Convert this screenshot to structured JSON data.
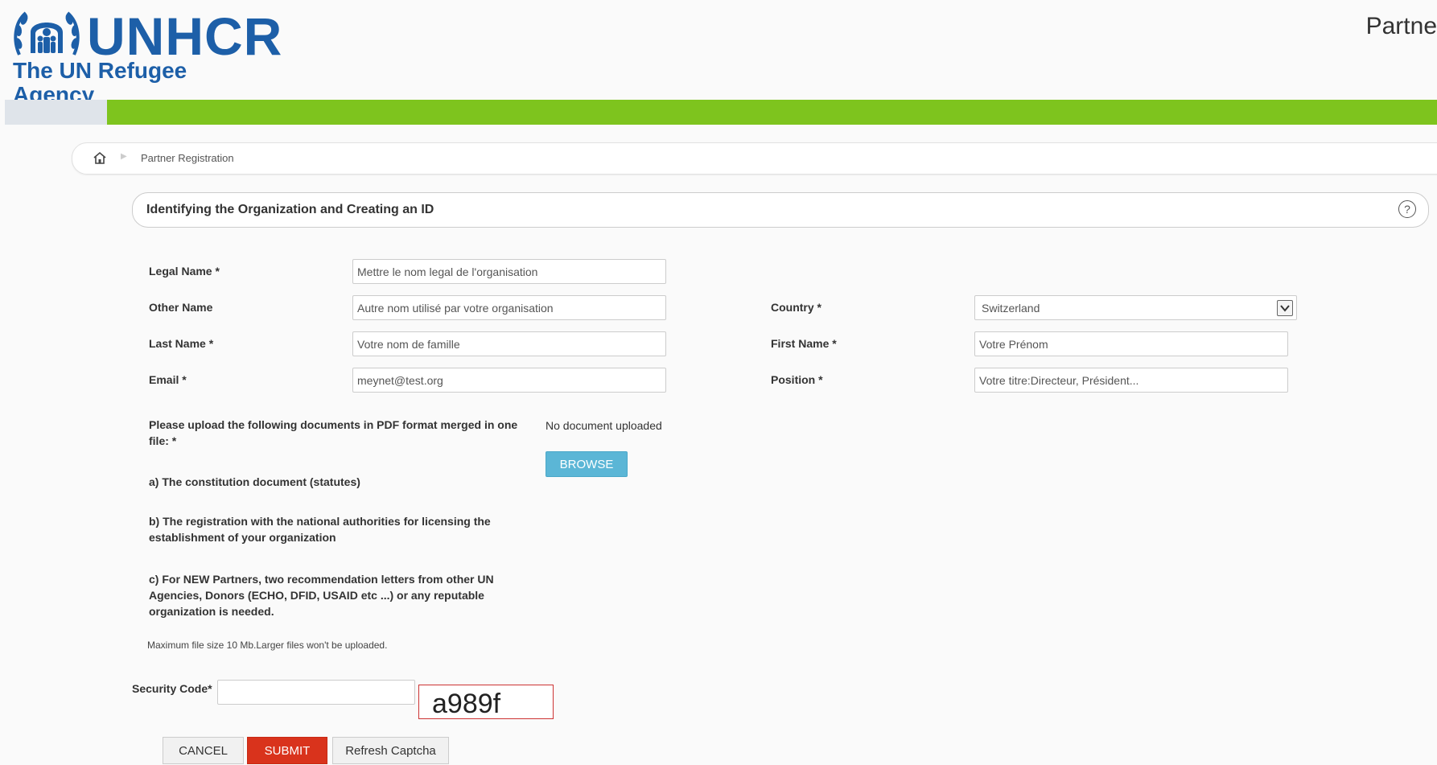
{
  "brand": {
    "logo_word": "UNHCR",
    "logo_tagline": "The UN Refugee Agency",
    "portal_title": "Partne",
    "color_blue": "#1d5fa8",
    "color_green": "#7ec41e"
  },
  "breadcrumb": {
    "home_icon": "home-icon",
    "current": "Partner Registration"
  },
  "section": {
    "title": "Identifying the Organization and Creating an ID",
    "help_icon": "?"
  },
  "form": {
    "legal_name": {
      "label": "Legal Name *",
      "value": "Mettre le nom legal de l'organisation"
    },
    "other_name": {
      "label": "Other Name",
      "value": "Autre nom utilisé par votre organisation"
    },
    "last_name": {
      "label": "Last Name *",
      "value": "Votre nom de famille"
    },
    "email": {
      "label": "Email *",
      "value": "meynet@test.org"
    },
    "country": {
      "label": "Country *",
      "value": "Switzerland"
    },
    "first_name": {
      "label": "First Name *",
      "value": "Votre Prénom"
    },
    "position": {
      "label": "Position *",
      "value": "Votre titre:Directeur, Président..."
    }
  },
  "upload": {
    "instruction": "Please upload the following documents in PDF format merged in one file: *",
    "item_a": "a) The constitution document (statutes)",
    "item_b": "b) The registration with the national authorities for licensing the establishment of your organization",
    "item_c": "c) For NEW Partners, two recommendation letters from other UN Agencies, Donors (ECHO, DFID, USAID etc ...) or any reputable organization is needed.",
    "status": "No document uploaded",
    "browse_label": "BROWSE",
    "max_size_note": "Maximum file size 10 Mb.Larger files won't be uploaded."
  },
  "security": {
    "label": "Security Code*",
    "value": "",
    "captcha_text": "a989f"
  },
  "actions": {
    "cancel": "CANCEL",
    "submit": "SUBMIT",
    "refresh": "Refresh Captcha"
  }
}
